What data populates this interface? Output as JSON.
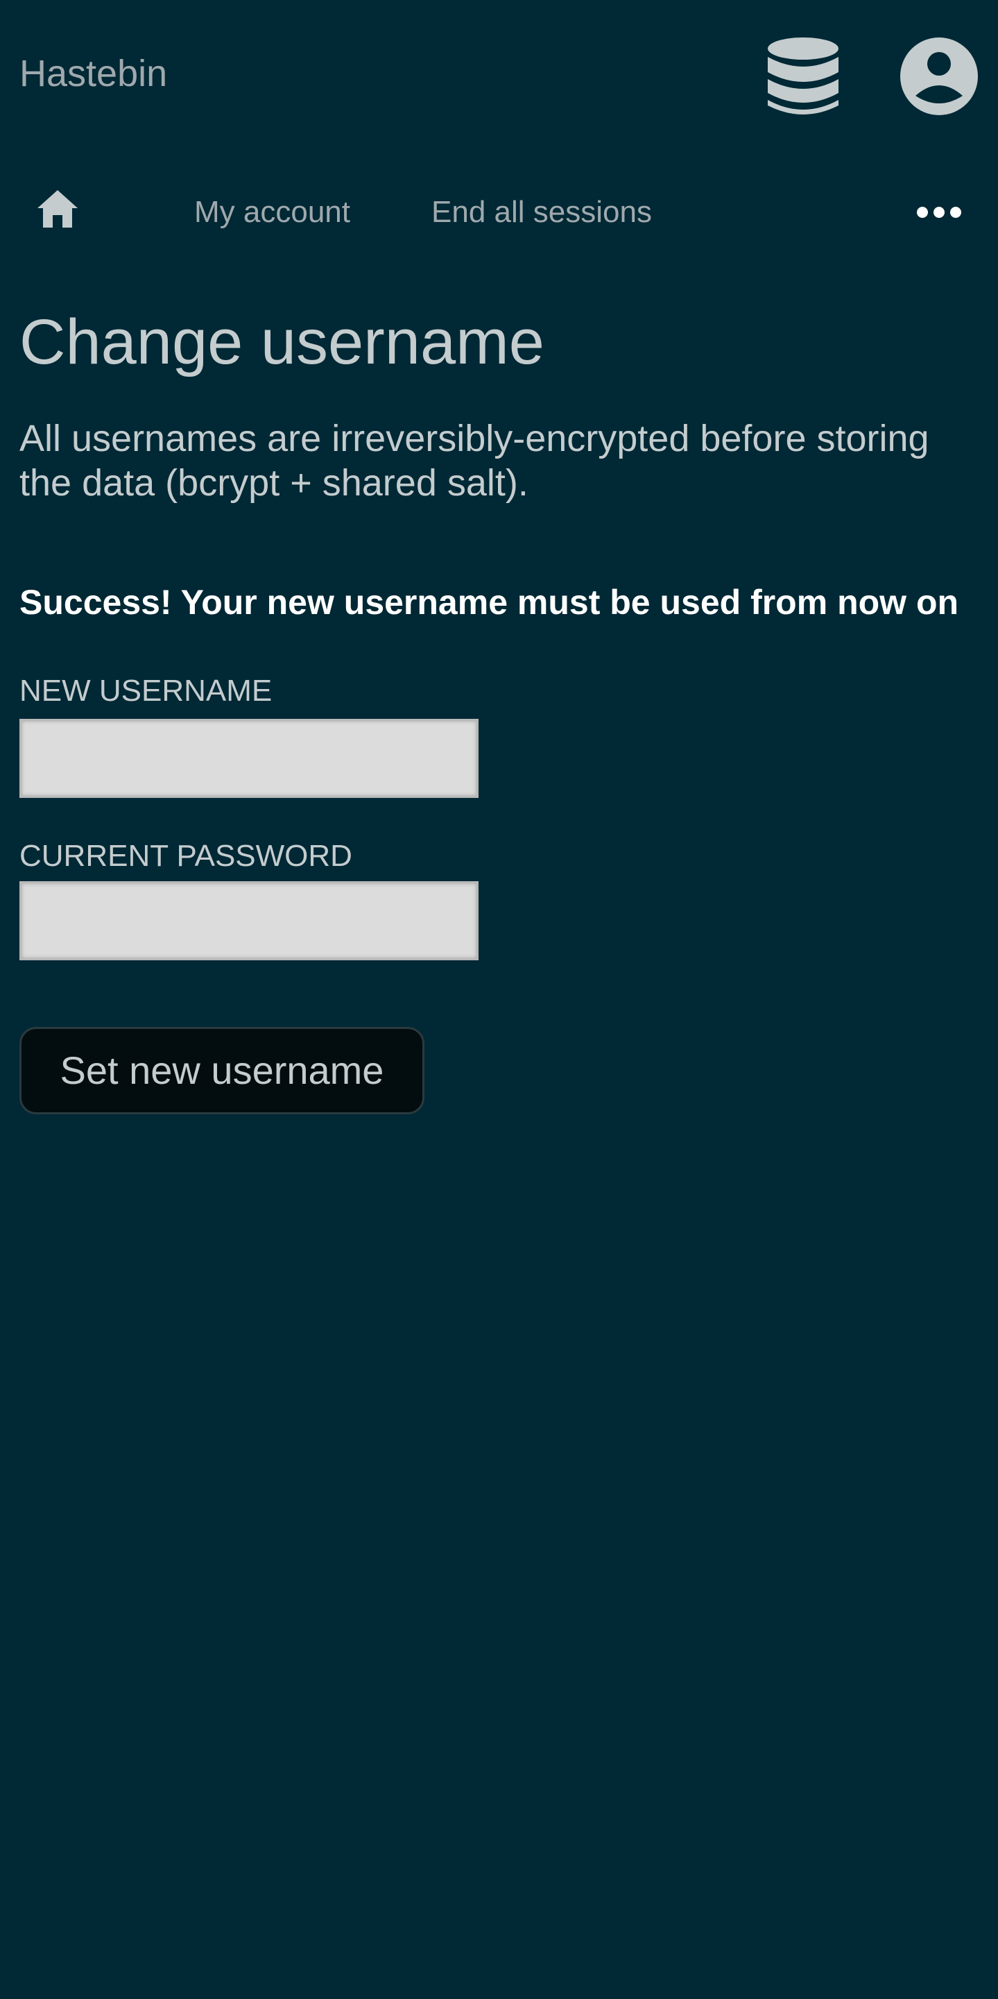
{
  "header": {
    "brand": "Hastebin",
    "database_icon": "database-icon",
    "account_icon": "user-circle-icon"
  },
  "nav": {
    "home_icon": "home-icon",
    "items": [
      {
        "label": "My account"
      },
      {
        "label": "End all sessions"
      }
    ],
    "more_icon": "ellipsis-icon"
  },
  "main": {
    "title": "Change username",
    "description": "All usernames are irreversibly-encrypted before storing the data (bcrypt + shared salt).",
    "success_message": "Success! Your new username must be used from now on",
    "form": {
      "new_username_label": "NEW USERNAME",
      "new_username_value": "",
      "current_password_label": "CURRENT PASSWORD",
      "current_password_value": "",
      "submit_label": "Set new username"
    }
  },
  "colors": {
    "background": "#002835",
    "text": "#c4ccce",
    "muted_text": "#9fa9ad",
    "success_text": "#ffffff",
    "input_background": "#dcdcdc",
    "button_background": "#030c0e"
  }
}
